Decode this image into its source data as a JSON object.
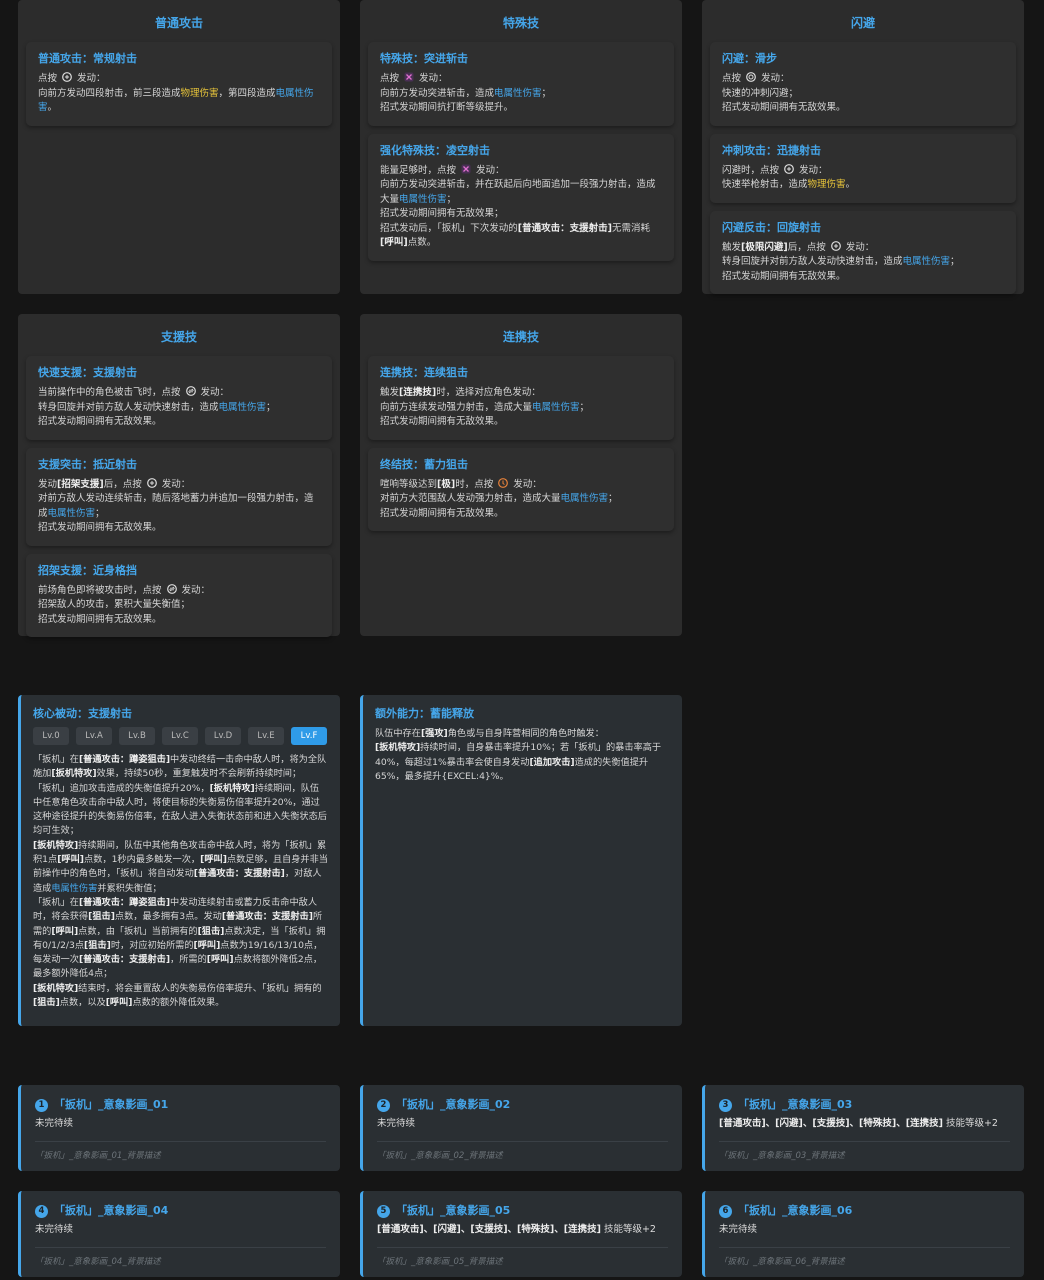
{
  "sections": {
    "normal": {
      "title": "普通攻击",
      "cards": [
        {
          "title": "普通攻击：常规射击"
        }
      ]
    },
    "special": {
      "title": "特殊技",
      "cards": [
        {
          "title": "特殊技：突进斩击"
        },
        {
          "title": "强化特殊技：凌空射击"
        }
      ]
    },
    "dodge": {
      "title": "闪避",
      "cards": [
        {
          "title": "闪避：滑步"
        },
        {
          "title": "冲刺攻击：迅捷射击"
        },
        {
          "title": "闪避反击：回旋射击"
        }
      ]
    },
    "assist": {
      "title": "支援技",
      "cards": [
        {
          "title": "快速支援：支援射击"
        },
        {
          "title": "支援突击：抵近射击"
        },
        {
          "title": "招架支援：近身格挡"
        }
      ]
    },
    "chain": {
      "title": "连携技",
      "cards": [
        {
          "title": "连携技：连续狙击"
        },
        {
          "title": "终结技：蓄力狙击"
        }
      ]
    }
  },
  "passive": {
    "title": "核心被动：支援射击",
    "levels": [
      "Lv.0",
      "Lv.A",
      "Lv.B",
      "Lv.C",
      "Lv.D",
      "Lv.E",
      "Lv.F"
    ],
    "active_level": "Lv.F"
  },
  "extra": {
    "title": "额外能力：蓄能释放"
  },
  "minds": [
    {
      "num": "1",
      "title": "「扳机」_意象影画_01",
      "desc": "未完待续",
      "note": "「扳机」_意象影画_01_背景描述"
    },
    {
      "num": "2",
      "title": "「扳机」_意象影画_02",
      "desc": "未完待续",
      "note": "「扳机」_意象影画_02_背景描述"
    },
    {
      "num": "3",
      "title": "「扳机」_意象影画_03",
      "desc_bold": "[普通攻击]、[闪避]、[支援技]、[特殊技]、[连携技]",
      "desc_tail": " 技能等级+2",
      "note": "「扳机」_意象影画_03_背景描述"
    },
    {
      "num": "4",
      "title": "「扳机」_意象影画_04",
      "desc": "未完待续",
      "note": "「扳机」_意象影画_04_背景描述"
    },
    {
      "num": "5",
      "title": "「扳机」_意象影画_05",
      "desc_bold": "[普通攻击]、[闪避]、[支援技]、[特殊技]、[连携技]",
      "desc_tail": " 技能等级+2",
      "note": "「扳机」_意象影画_05_背景描述"
    },
    {
      "num": "6",
      "title": "「扳机」_意象影画_06",
      "desc": "未完待续",
      "note": "「扳机」_意象影画_06_背景描述"
    }
  ],
  "colors": {
    "accent": "#45a6ea",
    "physical": "#e8c53a",
    "bg": "#151515",
    "panel": "#2c2c2c"
  }
}
